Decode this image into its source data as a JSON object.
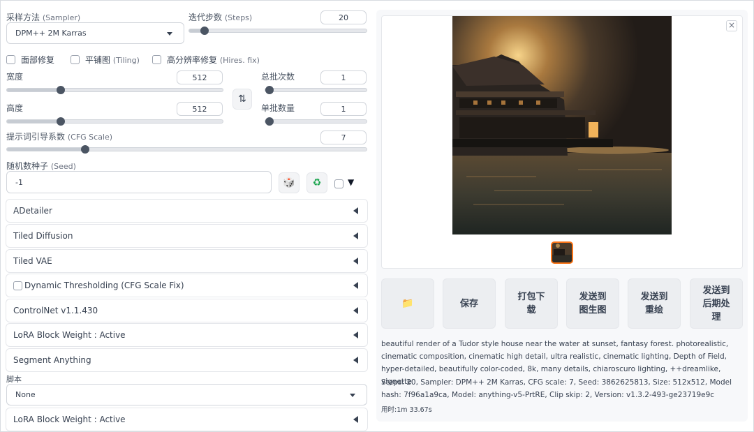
{
  "sampler": {
    "label": "采样方法",
    "label_en": "(Sampler)",
    "value": "DPM++ 2M Karras"
  },
  "steps": {
    "label": "迭代步数",
    "label_en": "(Steps)",
    "value": "20",
    "fraction": 0.065
  },
  "checkboxes": [
    {
      "label": "面部修复",
      "label_en": ""
    },
    {
      "label": "平铺图",
      "label_en": "(Tiling)"
    },
    {
      "label": "高分辨率修复",
      "label_en": "(Hires. fix)"
    }
  ],
  "width": {
    "label": "宽度",
    "value": "512",
    "fraction": 0.24
  },
  "height": {
    "label": "高度",
    "value": "512",
    "fraction": 0.24
  },
  "batch_count": {
    "label": "总批次数",
    "value": "1",
    "fraction": 0.0
  },
  "batch_size": {
    "label": "单批数量",
    "value": "1",
    "fraction": 0.0
  },
  "swap_icon": "⇅",
  "cfg": {
    "label": "提示词引导系数",
    "label_en": "(CFG Scale)",
    "value": "7",
    "fraction": 0.21
  },
  "seed": {
    "label": "随机数种子",
    "label_en": "(Seed)",
    "value": "-1",
    "dice_icon": "🎲",
    "recycle_icon": "♻"
  },
  "extra_toggle_icon": "▼",
  "accordions": [
    {
      "label": "ADetailer"
    },
    {
      "label": "Tiled Diffusion"
    },
    {
      "label": "Tiled VAE"
    },
    {
      "label": "Dynamic Thresholding (CFG Scale Fix)"
    },
    {
      "label": "ControlNet v1.1.430"
    },
    {
      "label": "LoRA Block Weight : Active"
    },
    {
      "label": "Segment Anything"
    }
  ],
  "script": {
    "label": "脚本",
    "value": "None"
  },
  "script_accordion": {
    "label": "LoRA Block Weight : Active"
  },
  "close_icon": "×",
  "actions": [
    {
      "name": "open-folder",
      "label": "",
      "icon": "📁"
    },
    {
      "name": "save",
      "label": "保存"
    },
    {
      "name": "zip",
      "label": "打包下载"
    },
    {
      "name": "send-img2img",
      "label": "发送到图生图"
    },
    {
      "name": "send-inpaint",
      "label": "发送到重绘"
    },
    {
      "name": "send-extras",
      "label": "发送到后期处理"
    }
  ],
  "output_info": {
    "prompt": "beautiful render of a Tudor style house near the water at sunset, fantasy forest. photorealistic, cinematic composition, cinematic high detail, ultra realistic, cinematic lighting, Depth of Field, hyper-detailed, beautifully color-coded, 8k, many details, chiaroscuro lighting, ++dreamlike, vignette",
    "params": "Steps: 20, Sampler: DPM++ 2M Karras, CFG scale: 7, Seed: 3862625813, Size: 512x512, Model hash: 7f96a1a9ca, Model: anything-v5-PrtRE, Clip skip: 2, Version: v1.3.2-493-ge23719e9c",
    "time_label": "用时:",
    "time_value": "1m 33.67s"
  },
  "colors": {
    "slider_thumb": "#4b5563",
    "accent": "#f97316"
  }
}
